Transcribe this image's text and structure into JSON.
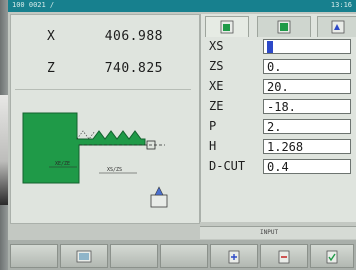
{
  "status_bar": {
    "left_text": "100 0021 /",
    "right_text": "13:16"
  },
  "position": {
    "rows": [
      {
        "axis": "X",
        "value": "406.988"
      },
      {
        "axis": "Z",
        "value": "740.825"
      }
    ]
  },
  "params": [
    {
      "label": "XS",
      "value": ""
    },
    {
      "label": "ZS",
      "value": "0."
    },
    {
      "label": "XE",
      "value": "20."
    },
    {
      "label": "ZE",
      "value": "-18."
    },
    {
      "label": "P",
      "value": "2."
    },
    {
      "label": "H",
      "value": "1.268"
    },
    {
      "label": "D-CUT",
      "value": "0.4"
    }
  ],
  "tabs": [
    {
      "icon": "thread-profile-icon"
    },
    {
      "icon": "thread-table-icon"
    },
    {
      "icon": "tool-data-icon"
    }
  ],
  "info_strip": {
    "text": "INPUT"
  },
  "colors": {
    "status_bar": "#17808e",
    "diagram_fill": "#1f9a48",
    "cursor": "#2d49c8"
  }
}
